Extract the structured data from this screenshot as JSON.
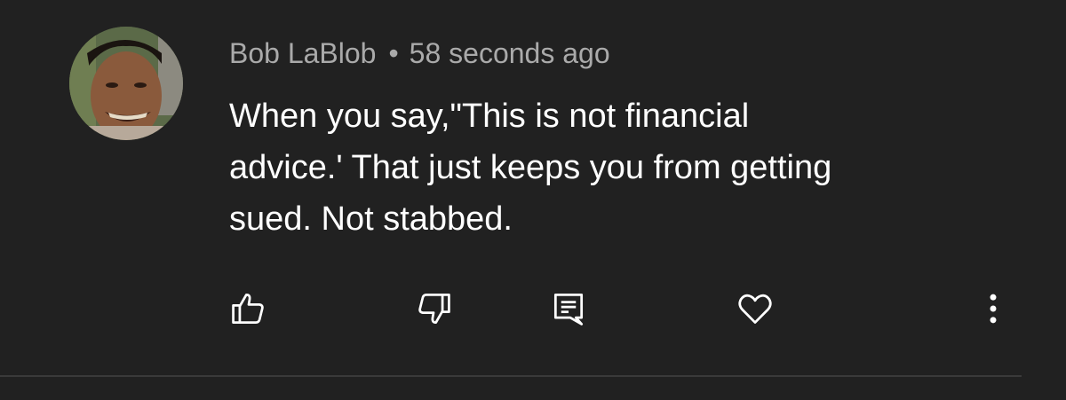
{
  "comment": {
    "author": "Bob LaBlob",
    "separator": "•",
    "timestamp": "58 seconds ago",
    "text_lines": [
      "When you say,\"This is not financial",
      "advice.' That just keeps you from getting",
      "sued. Not stabbed."
    ]
  },
  "actions": [
    {
      "name": "like",
      "icon": "thumbs-up-icon"
    },
    {
      "name": "dislike",
      "icon": "thumbs-down-icon"
    },
    {
      "name": "reply",
      "icon": "comment-reply-icon"
    },
    {
      "name": "heart",
      "icon": "heart-icon"
    },
    {
      "name": "more",
      "icon": "more-vertical-icon"
    }
  ],
  "colors": {
    "background": "#212121",
    "text": "#ffffff",
    "meta_text": "#aaaaaa",
    "divider": "#3a3a3a"
  }
}
